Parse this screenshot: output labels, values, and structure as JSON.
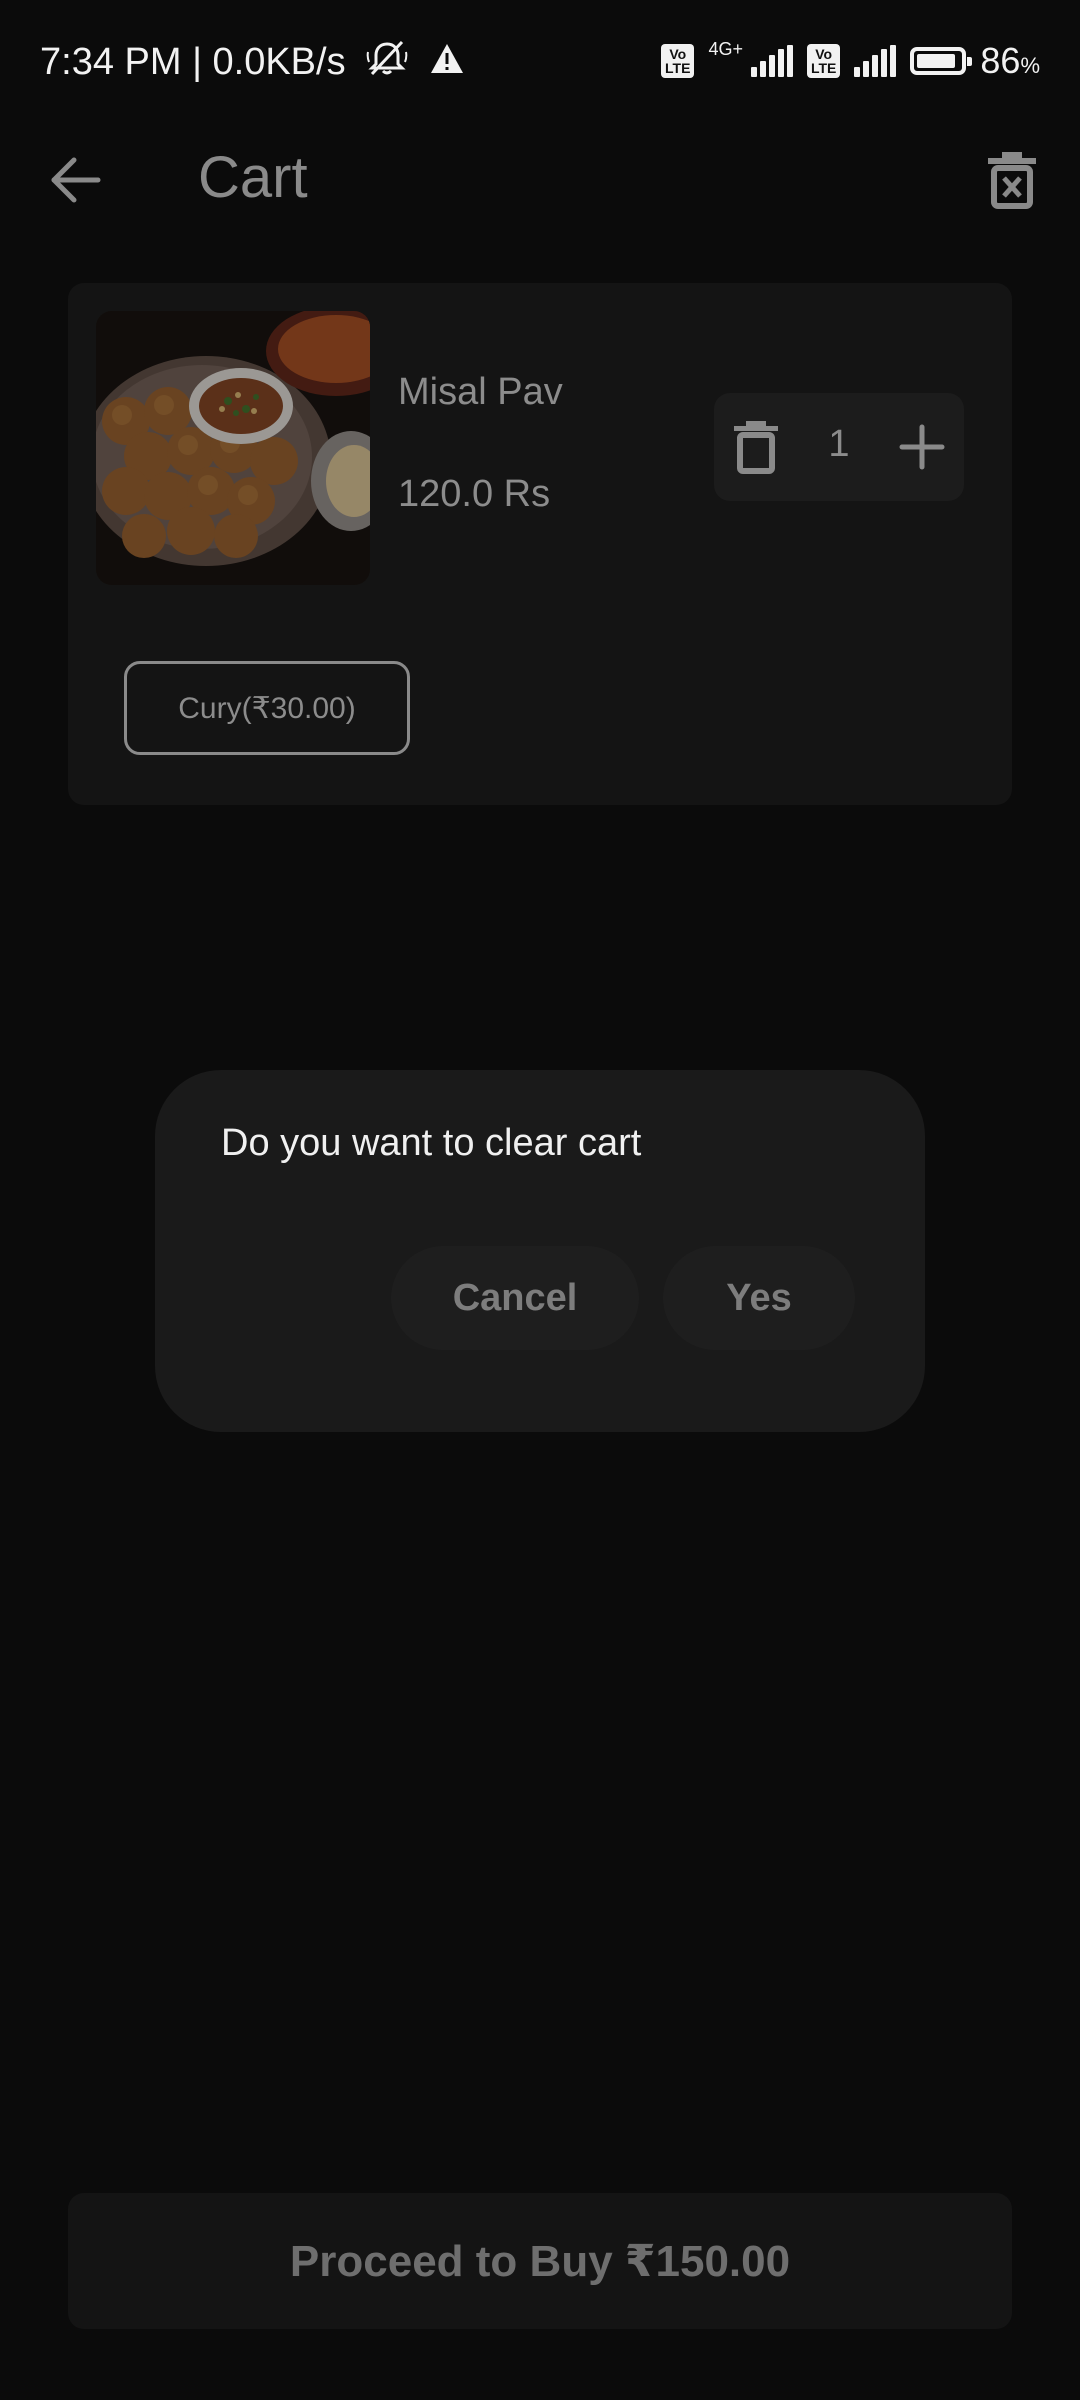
{
  "status_bar": {
    "time_speed": "7:34 PM | 0.0KB/s",
    "volte_label": "Vo\nLTE",
    "network_type": "4G+",
    "battery_percent": "86",
    "battery_unit": "%"
  },
  "app_bar": {
    "title": "Cart",
    "back_icon": "arrow-left-icon",
    "clear_icon": "trash-x-icon"
  },
  "cart": {
    "items": [
      {
        "name": "Misal Pav",
        "price": "120.0 Rs",
        "quantity": "1",
        "image": "misal-pav-food-photo",
        "addons": [
          "Cury(₹30.00)"
        ]
      }
    ]
  },
  "dialog": {
    "message": "Do you want to clear cart",
    "cancel_label": "Cancel",
    "yes_label": "Yes"
  },
  "footer": {
    "proceed_label": "Proceed to Buy ₹150.00"
  },
  "colors": {
    "background": "#0b0b0b",
    "card": "#141414",
    "dialog": "#1a1a1a",
    "muted_text": "#8c8c8c"
  }
}
